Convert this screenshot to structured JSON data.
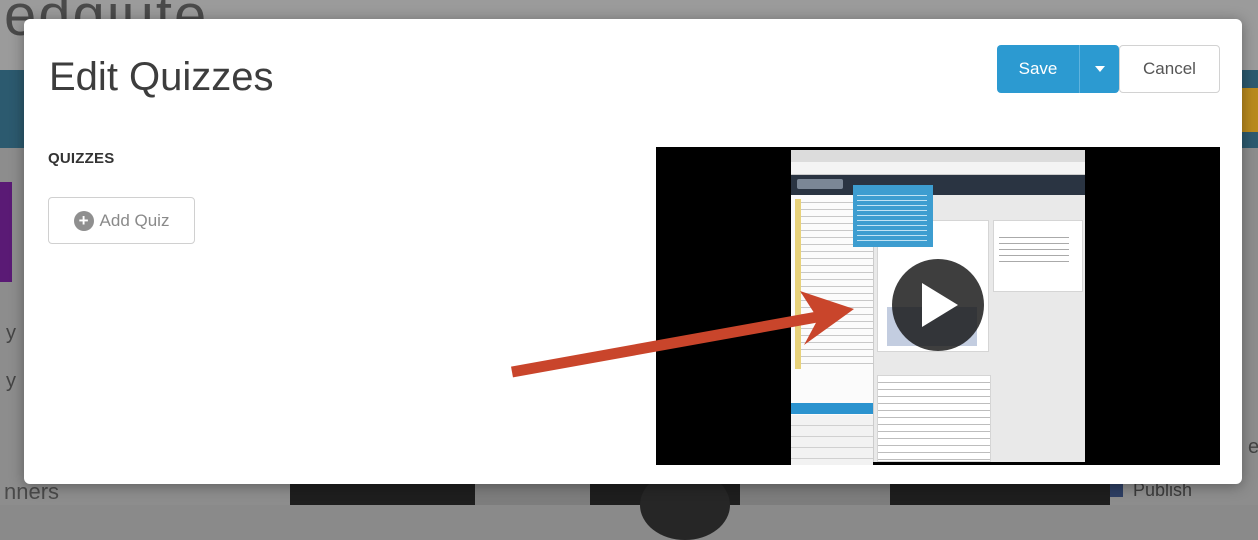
{
  "background": {
    "logo_text": "edgiute",
    "left_fragments": [
      "y",
      "y"
    ],
    "bottom_left_text": "nners",
    "publish_label": "Publish",
    "right_fragment": "e"
  },
  "modal": {
    "title": "Edit Quizzes",
    "save_label": "Save",
    "cancel_label": "Cancel",
    "section_label": "QUIZZES",
    "add_quiz_label": "Add Quiz",
    "video": {
      "play_icon": "play-icon",
      "arrow_color": "#c9452b"
    }
  },
  "colors": {
    "primary": "#2c9ad1",
    "arrow": "#c9452b"
  }
}
